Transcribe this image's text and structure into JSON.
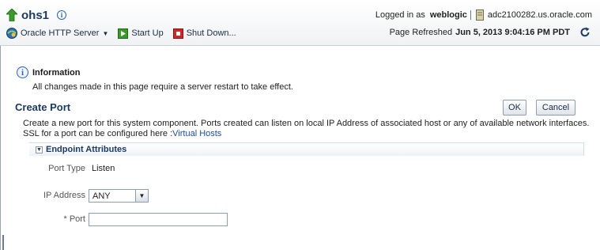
{
  "header": {
    "title": "ohs1",
    "login_label": "Logged in as",
    "username": "weblogic",
    "host": "adc2100282.us.oracle.com",
    "refresh_label": "Page Refreshed",
    "refresh_time": "Jun 5, 2013 9:04:16 PM PDT"
  },
  "toolbar": {
    "menu_label": "Oracle HTTP Server",
    "start_label": "Start Up",
    "shutdown_label": "Shut Down..."
  },
  "info": {
    "title": "Information",
    "message": "All changes made in this page require a server restart to take effect."
  },
  "page": {
    "title": "Create Port",
    "ok_label": "OK",
    "cancel_label": "Cancel",
    "description_line1": "Create a new port for this system component. Ports created can listen on local IP Address of associated host or any of available network interfaces.",
    "description_line2_prefix": "SSL for a port can be configured here :",
    "virtual_hosts_link": "Virtual Hosts"
  },
  "endpoint": {
    "section_title": "Endpoint Attributes",
    "port_type_label": "Port Type",
    "port_type_value": "Listen",
    "ip_label": "IP Address",
    "ip_value": "ANY",
    "port_required": "*",
    "port_label": "Port",
    "port_value": ""
  },
  "colors": {
    "title_blue": "#1d3a62",
    "link_blue": "#1a4f9c",
    "start_green": "#3a9a2a",
    "shutdown_red": "#cc2a2a"
  },
  "icons": [
    "up-arrow-icon",
    "info-icon",
    "server-icon",
    "oracle-http-server-icon",
    "start-up-icon",
    "shut-down-icon",
    "refresh-icon",
    "collapse-icon",
    "dropdown-arrow-icon"
  ]
}
